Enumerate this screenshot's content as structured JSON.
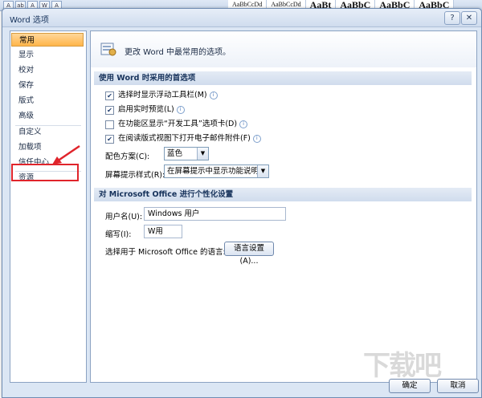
{
  "ribbon": {
    "icons": [
      "A",
      "ab",
      "A",
      "W",
      "A"
    ],
    "styles": [
      "AaBbCcDd",
      "AaBbCcDd",
      "AaBt",
      "AaBbC",
      "AaBbC",
      "AaBbC"
    ]
  },
  "dialog": {
    "title": "Word 选项",
    "help_glyph": "?",
    "close_glyph": "✕"
  },
  "nav": {
    "items": [
      {
        "label": "常用"
      },
      {
        "label": "显示"
      },
      {
        "label": "校对"
      },
      {
        "label": "保存"
      },
      {
        "label": "版式"
      },
      {
        "label": "高级"
      },
      {
        "label": "自定义"
      },
      {
        "label": "加载项"
      },
      {
        "label": "信任中心"
      },
      {
        "label": "资源"
      }
    ],
    "selected_index": 0,
    "highlighted_label": "信任中心",
    "highlight_color": "#e0242b"
  },
  "main": {
    "intro_text": "更改 Word 中最常用的选项。",
    "section1_title": "使用 Word 时采用的首选项",
    "options": [
      {
        "label": "选择时显示浮动工具栏(M)",
        "checked": true
      },
      {
        "label": "启用实时预览(L)",
        "checked": true
      },
      {
        "label": "在功能区显示“开发工具”选项卡(D)",
        "checked": false
      },
      {
        "label": "在阅读版式视图下打开电子邮件附件(F)",
        "checked": true
      }
    ],
    "color_scheme_label": "配色方案(C):",
    "color_scheme_value": "蓝色",
    "tooltip_style_label": "屏幕提示样式(R):",
    "tooltip_style_value": "在屏幕提示中显示功能说明",
    "section2_title": "对 Microsoft Office 进行个性化设置",
    "username_label": "用户名(U):",
    "username_value": "Windows 用户",
    "initials_label": "缩写(I):",
    "initials_value": "W用",
    "language_label": "选择用于 Microsoft Office 的语言:",
    "language_button": "语言设置(A)..."
  },
  "footer": {
    "ok_label": "确定",
    "cancel_label": "取消"
  },
  "watermark": "下载吧",
  "glyphs": {
    "check": "✔",
    "arrow_down": "▼",
    "info": "i"
  }
}
